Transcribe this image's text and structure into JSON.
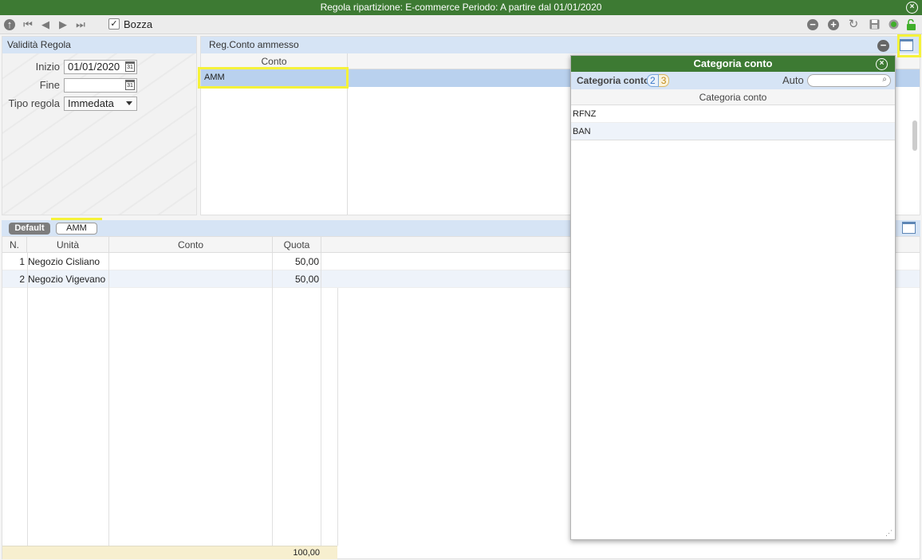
{
  "window": {
    "title": "Regola ripartizione: E-commerce Periodo: A partire dal 01/01/2020"
  },
  "toolbar": {
    "bozza_label": "Bozza",
    "bozza_checked": "✓"
  },
  "validita": {
    "header": "Validità Regola",
    "inizio_label": "Inizio",
    "inizio_value": "01/01/2020",
    "fine_label": "Fine",
    "fine_value": "",
    "tipo_label": "Tipo regola",
    "tipo_value": "Immedata"
  },
  "reg_conto": {
    "header": "Reg.Conto ammesso",
    "column": "Conto",
    "rows": [
      "AMM"
    ]
  },
  "popup": {
    "title": "Categoria conto",
    "bar_label": "Categoria conto",
    "badge_a": "2",
    "badge_b": "3",
    "auto_label": "Auto",
    "search_value": "",
    "column": "Categoria conto",
    "rows": [
      "RFNZ",
      "BAN"
    ]
  },
  "tabs": {
    "default_label": "Default",
    "amm_label": "AMM"
  },
  "grid": {
    "headers": {
      "n": "N.",
      "unita": "Unità",
      "conto": "Conto",
      "quota": "Quota"
    },
    "rows": [
      {
        "n": "1",
        "unita": "Negozio Cisliano",
        "conto": "",
        "quota": "50,00"
      },
      {
        "n": "2",
        "unita": "Negozio Vigevano",
        "conto": "",
        "quota": "50,00"
      }
    ],
    "total": "100,00"
  },
  "colors": {
    "title_green": "#3d7a33",
    "header_blue": "#d6e4f5",
    "selected_row": "#b9d1ee",
    "highlight": "#f5f23a",
    "total_bg": "#f7efcf"
  }
}
